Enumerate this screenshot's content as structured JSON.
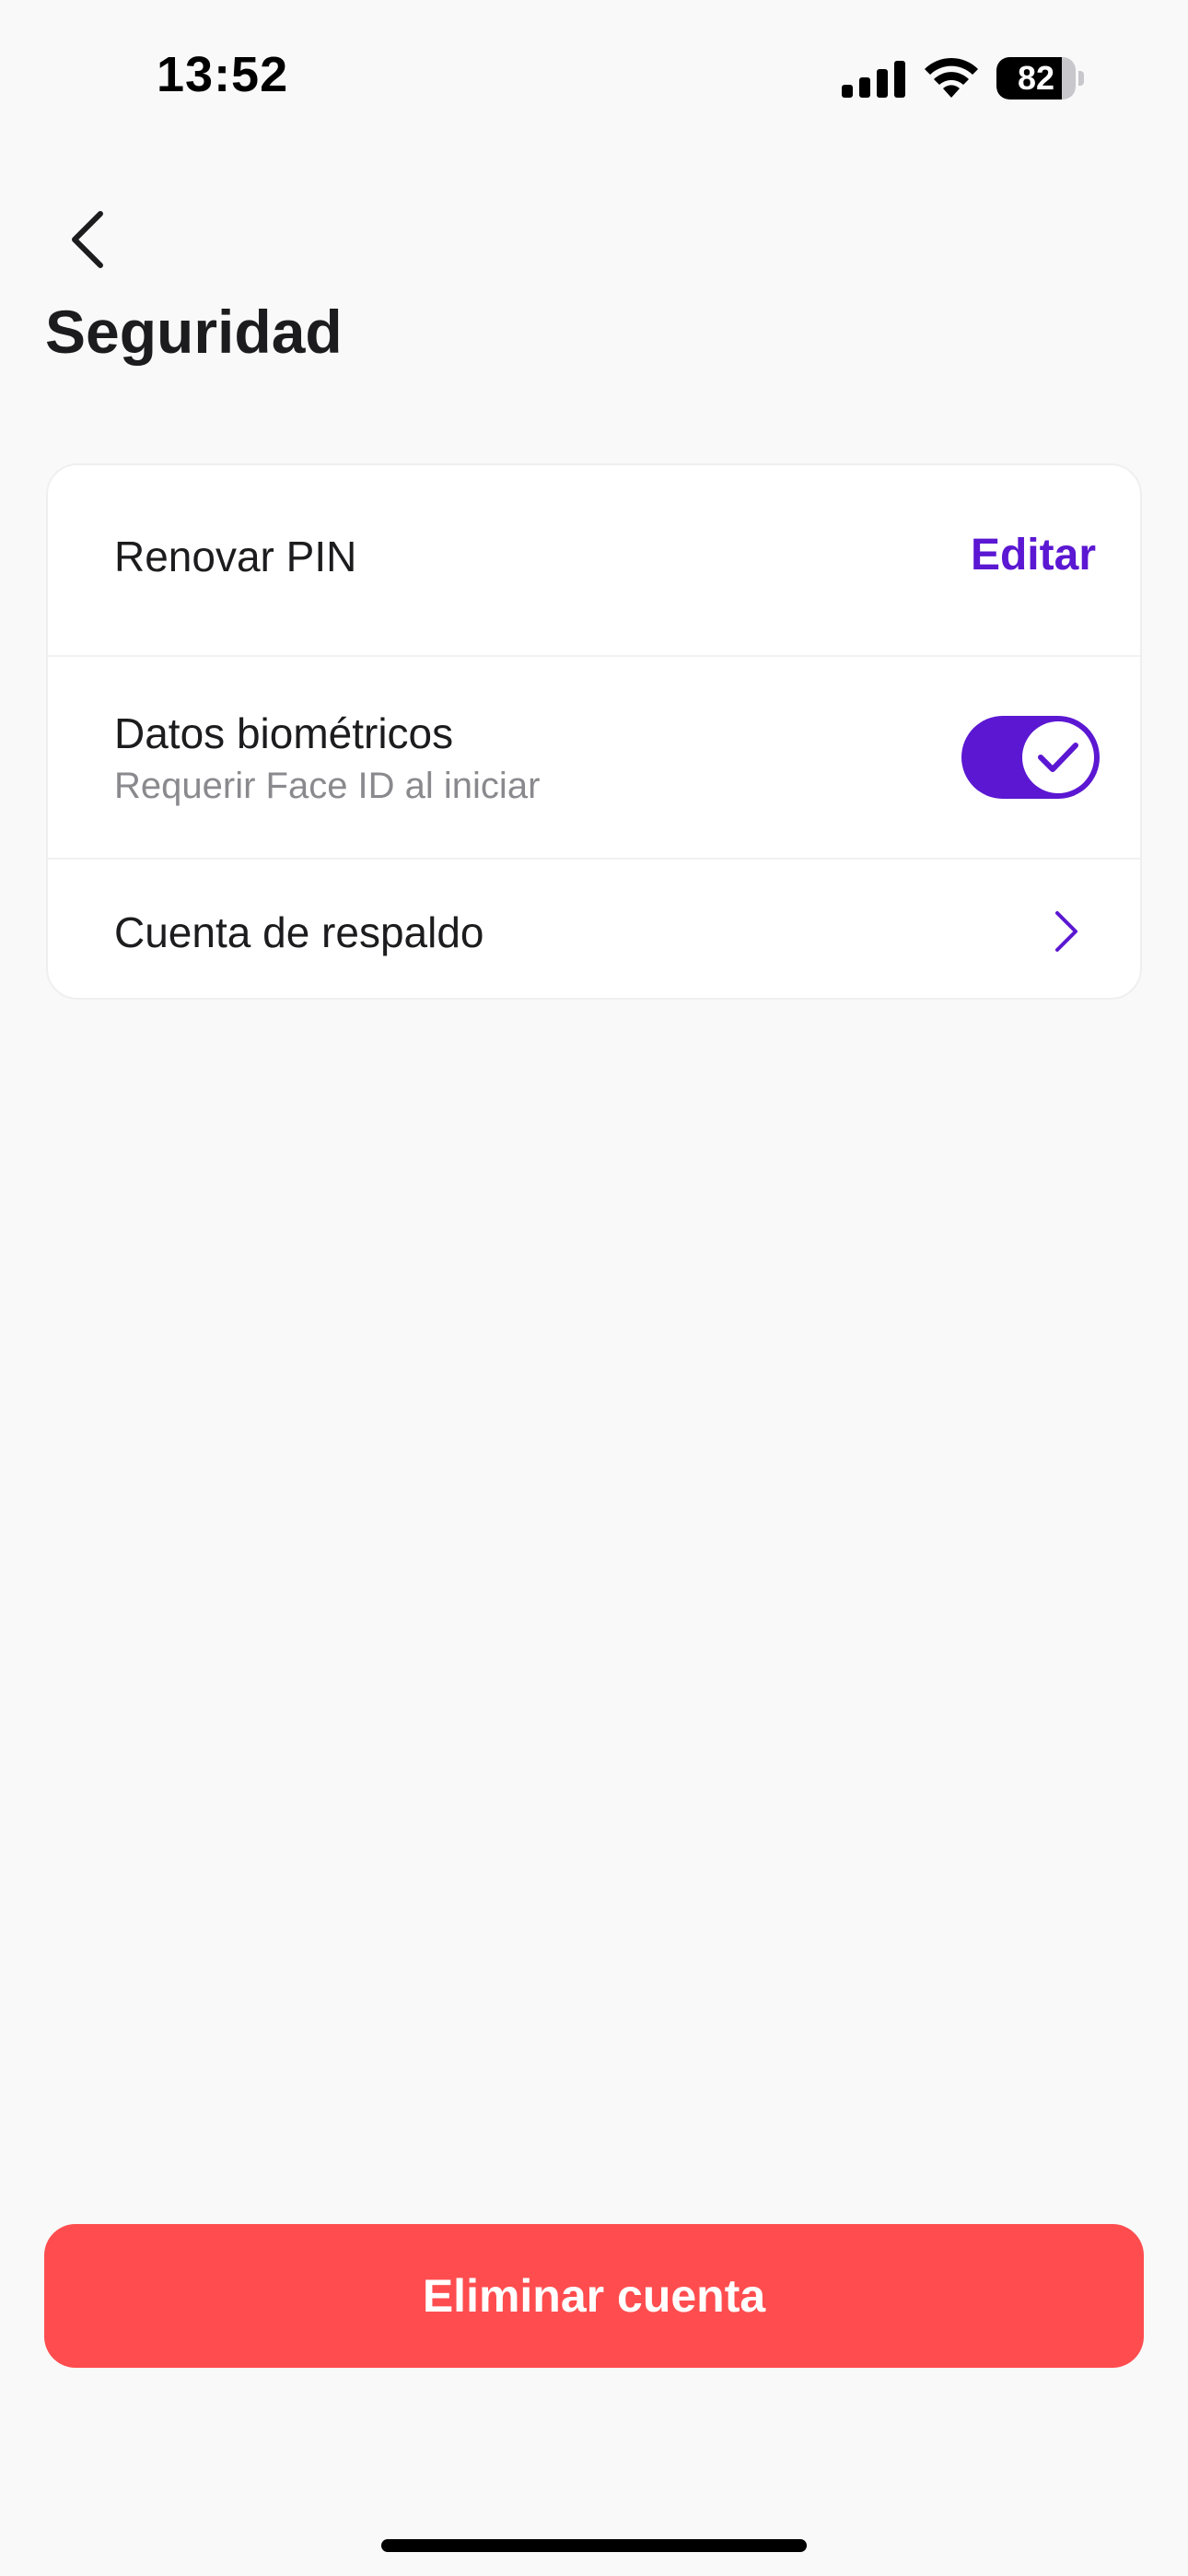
{
  "status_bar": {
    "time": "13:52",
    "battery_level": "82",
    "battery_fraction": 0.82
  },
  "nav": {
    "back_icon": "chevron-left-icon"
  },
  "page": {
    "title": "Seguridad"
  },
  "security": {
    "renew_pin": {
      "label": "Renovar PIN",
      "action_label": "Editar"
    },
    "biometrics": {
      "label": "Datos biométricos",
      "sublabel": "Requerir Face ID al iniciar",
      "enabled": true
    },
    "backup_account": {
      "label": "Cuenta de respaldo",
      "icon": "chevron-right-icon"
    }
  },
  "actions": {
    "delete_account_label": "Eliminar cuenta"
  },
  "colors": {
    "accent": "#5b17d2",
    "danger": "#ff4d4f",
    "background": "#f9f9f9",
    "card": "#ffffff",
    "secondary_text": "#8a8a8e"
  }
}
